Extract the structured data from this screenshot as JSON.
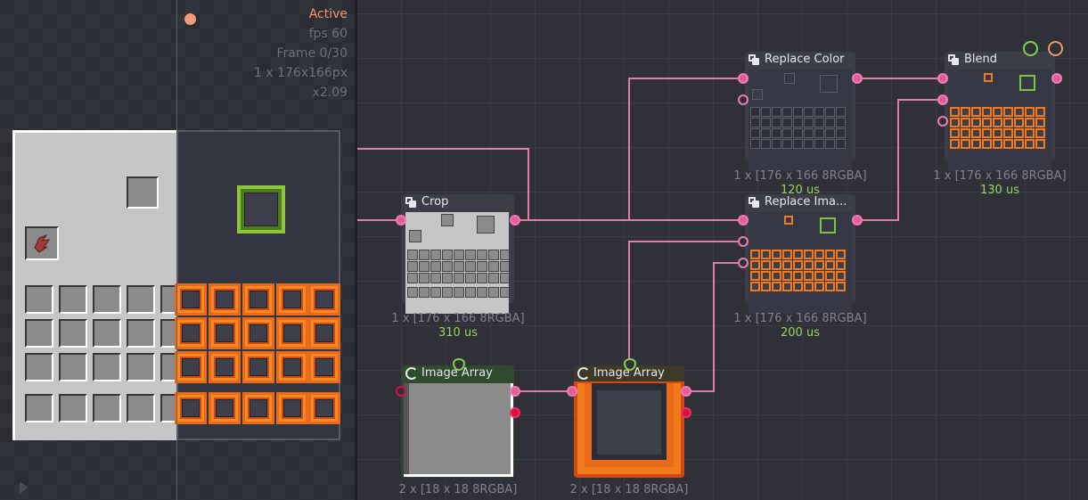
{
  "preview": {
    "status": "Active",
    "fps": "fps 60",
    "frame": "Frame 0/30",
    "size": "1 x 176x166px",
    "zoom": "x2.09"
  },
  "nodes": {
    "crop": {
      "title": "Crop",
      "footer": "1 x [176 x 166 8RGBA]",
      "time": "310 us"
    },
    "replace_color": {
      "title": "Replace Color",
      "footer": "1 x [176 x 166 8RGBA]",
      "time": "120 us"
    },
    "replace_image": {
      "title": "Replace Ima...",
      "footer": "1 x [176 x 166 8RGBA]",
      "time": "200 us"
    },
    "blend": {
      "title": "Blend",
      "footer": "1 x [176 x 166 8RGBA]",
      "time": "130 us"
    },
    "image_array_1": {
      "title": "Image Array",
      "footer": "2 x [18 x 18 8RGBA]"
    },
    "image_array_2": {
      "title": "Image Array",
      "footer": "2 x [18 x 18 8RGBA]"
    }
  },
  "icons": {
    "node_icon": "duplicate-icon",
    "array_icon": "refresh-icon",
    "blend_extra": [
      "calculator-icon",
      "eye-icon"
    ]
  },
  "colors": {
    "wire": "#e57aa9",
    "accent_orange": "#f0956b",
    "time_green": "#9ad45c",
    "slot_orange": "#f07a1c"
  }
}
